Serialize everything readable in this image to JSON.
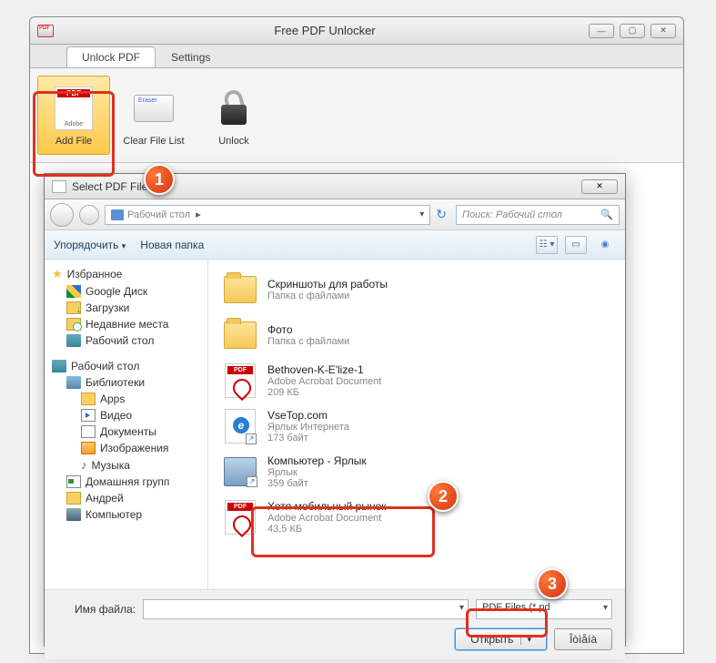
{
  "mainWindow": {
    "title": "Free PDF Unlocker",
    "tabs": {
      "unlock": "Unlock PDF",
      "settings": "Settings"
    },
    "ribbon": {
      "addFile": "Add File",
      "clearList": "Clear File List",
      "unlock": "Unlock"
    }
  },
  "dialog": {
    "title": "Select PDF File",
    "nav": {
      "path": "Рабочий стол",
      "searchPlaceholder": "Поиск: Рабочий стол"
    },
    "toolbar": {
      "organize": "Упорядочить",
      "newFolder": "Новая папка"
    },
    "sidebar": {
      "favorites": "Избранное",
      "favItems": {
        "gdrive": "Google Диск",
        "downloads": "Загрузки",
        "recent": "Недавние места",
        "desktop": "Рабочий стол"
      },
      "desktopHead": "Рабочий стол",
      "libs": "Библиотеки",
      "libItems": {
        "apps": "Apps",
        "video": "Видео",
        "docs": "Документы",
        "images": "Изображения",
        "music": "Музыка"
      },
      "homegroup": "Домашняя групп",
      "user": "Андрей",
      "computer": "Компьютер"
    },
    "files": [
      {
        "name": "Скриншоты для работы",
        "sub1": "Папка с файлами",
        "type": "folder"
      },
      {
        "name": "Фото",
        "sub1": "Папка с файлами",
        "type": "folder"
      },
      {
        "name": "Bethoven-K-E'lize-1",
        "sub1": "Adobe Acrobat Document",
        "sub2": "209 КБ",
        "type": "pdf"
      },
      {
        "name": "VseTop.com",
        "sub1": "Ярлык Интернета",
        "sub2": "173 байт",
        "type": "ie"
      },
      {
        "name": "Компьютер - Ярлык",
        "sub1": "Ярлык",
        "sub2": "359 байт",
        "type": "comp"
      },
      {
        "name": "Хотя мобильный рынок",
        "sub1": "Adobe Acrobat Document",
        "sub2": "43,5 КБ",
        "type": "pdf"
      }
    ],
    "footer": {
      "fileNameLabel": "Имя файла:",
      "filter": "PDF Files (*.pd",
      "open": "Открыть",
      "cancel": "Îòìåíà"
    }
  },
  "callouts": {
    "c1": "1",
    "c2": "2",
    "c3": "3"
  }
}
